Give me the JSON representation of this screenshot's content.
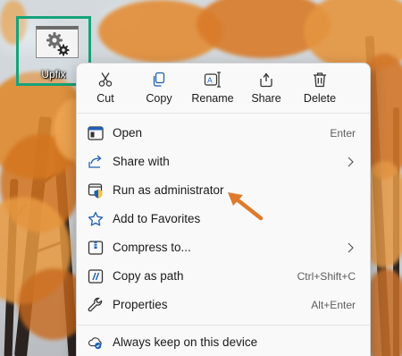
{
  "desktop": {
    "icon_label": "Upfix",
    "accent": "#17a27a"
  },
  "context_menu": {
    "toolbar": [
      {
        "name": "cut",
        "label": "Cut",
        "icon": "scissors-icon"
      },
      {
        "name": "copy",
        "label": "Copy",
        "icon": "copy-icon"
      },
      {
        "name": "rename",
        "label": "Rename",
        "icon": "rename-icon"
      },
      {
        "name": "share",
        "label": "Share",
        "icon": "share-icon"
      },
      {
        "name": "delete",
        "label": "Delete",
        "icon": "trash-icon"
      }
    ],
    "items": [
      {
        "label": "Open",
        "shortcut": "Enter",
        "icon": "open-icon"
      },
      {
        "label": "Share with",
        "shortcut": "",
        "icon": "share-with-icon",
        "submenu": true
      },
      {
        "label": "Run as administrator",
        "shortcut": "",
        "icon": "shield-icon"
      },
      {
        "label": "Add to Favorites",
        "shortcut": "",
        "icon": "star-icon"
      },
      {
        "label": "Compress to...",
        "shortcut": "",
        "icon": "archive-icon",
        "submenu": true
      },
      {
        "label": "Copy as path",
        "shortcut": "Ctrl+Shift+C",
        "icon": "path-icon"
      },
      {
        "label": "Properties",
        "shortcut": "Alt+Enter",
        "icon": "wrench-icon"
      },
      {
        "label": "Always keep on this device",
        "shortcut": "",
        "icon": "cloud-sync-icon"
      }
    ]
  },
  "annotation": {
    "arrow_color": "#e07a2b"
  }
}
